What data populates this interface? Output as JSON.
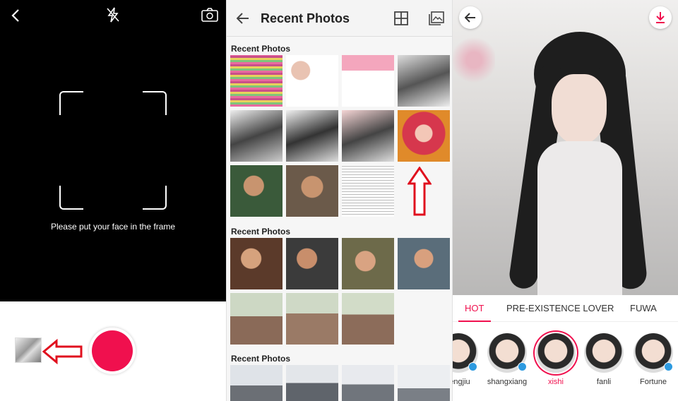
{
  "camera": {
    "hint": "Please put your face in the frame",
    "icons": [
      "back-chevron-icon",
      "flash-off-icon",
      "switch-camera-icon"
    ]
  },
  "gallery": {
    "title": "Recent Photos",
    "sections": [
      {
        "label": "Recent Photos",
        "rows": 3,
        "count": 12
      },
      {
        "label": "Recent Photos",
        "rows": 2,
        "count": 7
      },
      {
        "label": "Recent Photos",
        "rows": 1,
        "count": 4
      }
    ],
    "grid_captions": [
      "HOT",
      "PRE-EXISTENCE LOVER",
      "FUWA"
    ]
  },
  "result": {
    "tabs": [
      "HOT",
      "PRE-EXISTENCE LOVER",
      "FUWA"
    ],
    "active_tab": "HOT",
    "styles": [
      {
        "name": "engjiu",
        "selected": false,
        "download": true
      },
      {
        "name": "shangxiang",
        "selected": false,
        "download": true
      },
      {
        "name": "xishi",
        "selected": true,
        "download": false
      },
      {
        "name": "fanli",
        "selected": false,
        "download": false
      },
      {
        "name": "Fortune",
        "selected": false,
        "download": true
      }
    ]
  },
  "colors": {
    "accent": "#f0104e",
    "arrow": "#e0101e",
    "download_badge": "#2d9ae0"
  }
}
